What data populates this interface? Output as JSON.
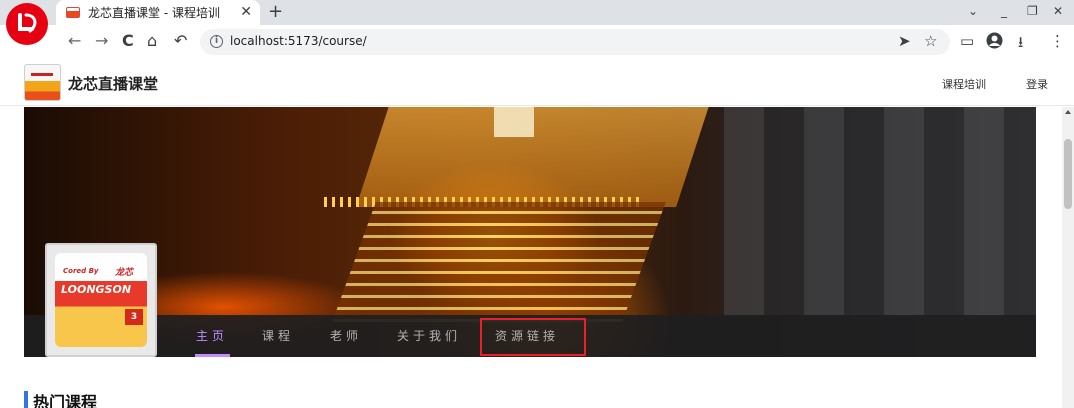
{
  "browser": {
    "tab_title": "龙芯直播课堂 - 课程培训",
    "tab_close": "✕",
    "new_tab": "+",
    "url": "localhost:5173/course/",
    "window_controls": {
      "dropdown": "⌄",
      "minimize": "_",
      "restore": "❐",
      "close": "✕"
    },
    "nav": {
      "back": "←",
      "forward": "→",
      "reload": "C",
      "home": "⌂",
      "undo": "↶"
    },
    "icons": {
      "logo": "loongson-logo-icon",
      "info": "info-icon",
      "send": "send-icon",
      "bookmark": "star-icon",
      "cast": "cast-icon",
      "profile": "profile-icon",
      "download": "download-icon",
      "menu": "kebab-menu-icon"
    }
  },
  "header": {
    "site_title": "龙芯直播课堂",
    "links": [
      "课程培训",
      "登录"
    ]
  },
  "banner": {
    "badge": {
      "cored_by": "Cored By",
      "cn": "龙芯",
      "brand": "LOONGSON",
      "num": "3"
    },
    "nav": [
      "主页",
      "课程",
      "老师",
      "关于我们",
      "资源链接"
    ],
    "active_index": 0,
    "highlighted_item": "资源链接"
  },
  "section": {
    "title": "热门课程"
  },
  "colors": {
    "accent_purple": "#c28cff",
    "highlight_red": "#e8222a",
    "section_blue": "#3274e0",
    "brand_red": "#e60012"
  }
}
